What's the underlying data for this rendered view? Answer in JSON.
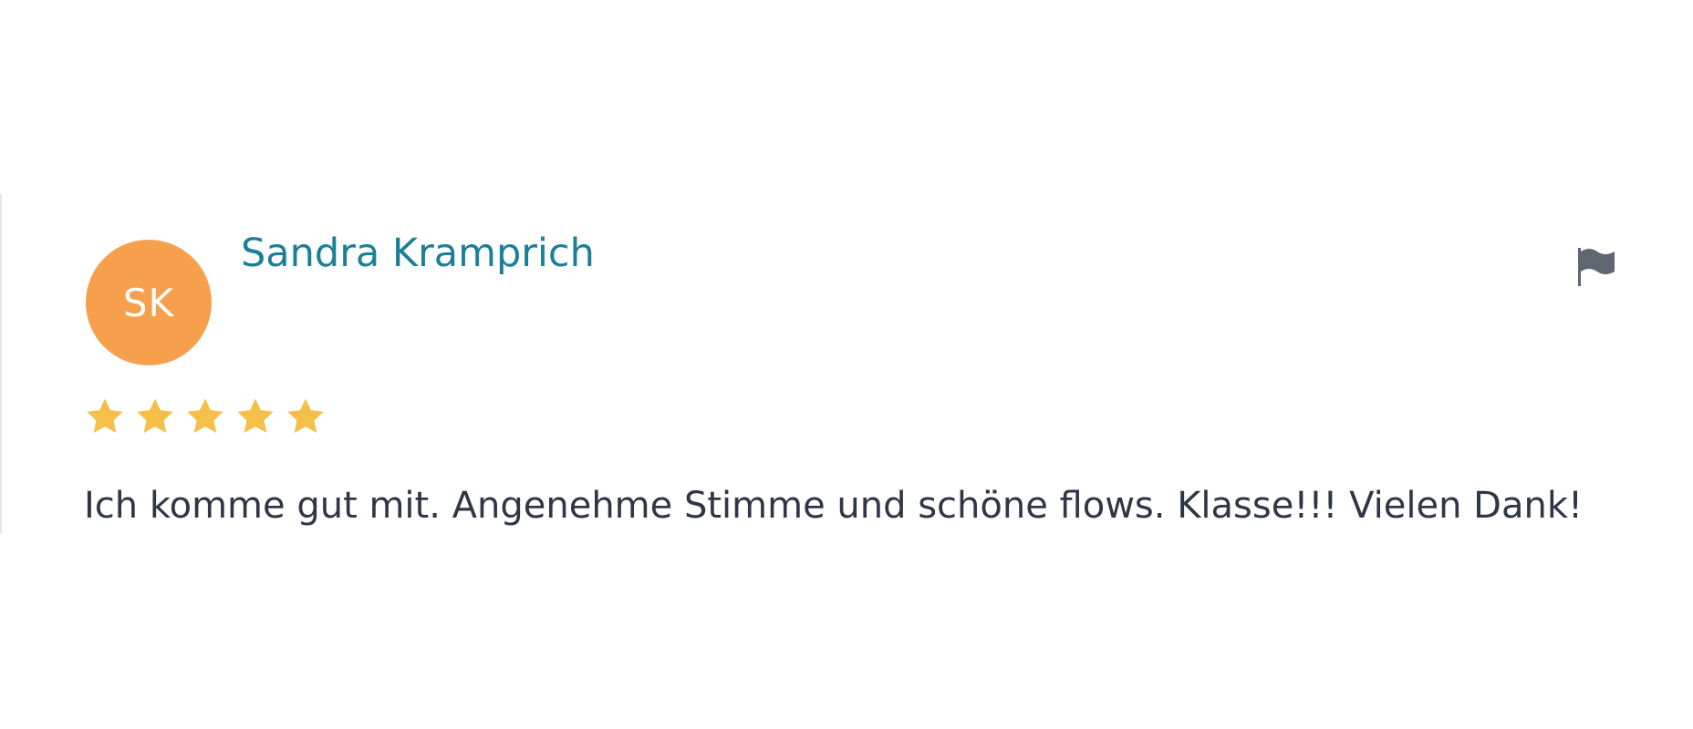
{
  "review": {
    "avatar_initials": "SK",
    "avatar_color": "#f6a04d",
    "reviewer_name": "Sandra Kramprich",
    "name_color": "#1b7f97",
    "rating": 5,
    "rating_max": 5,
    "star_color": "#f5c04a",
    "text": "Ich komme gut mit. Angenehme Stimme und schöne flows. Klasse!!! Vielen Dank!",
    "report_icon": "flag-icon"
  }
}
